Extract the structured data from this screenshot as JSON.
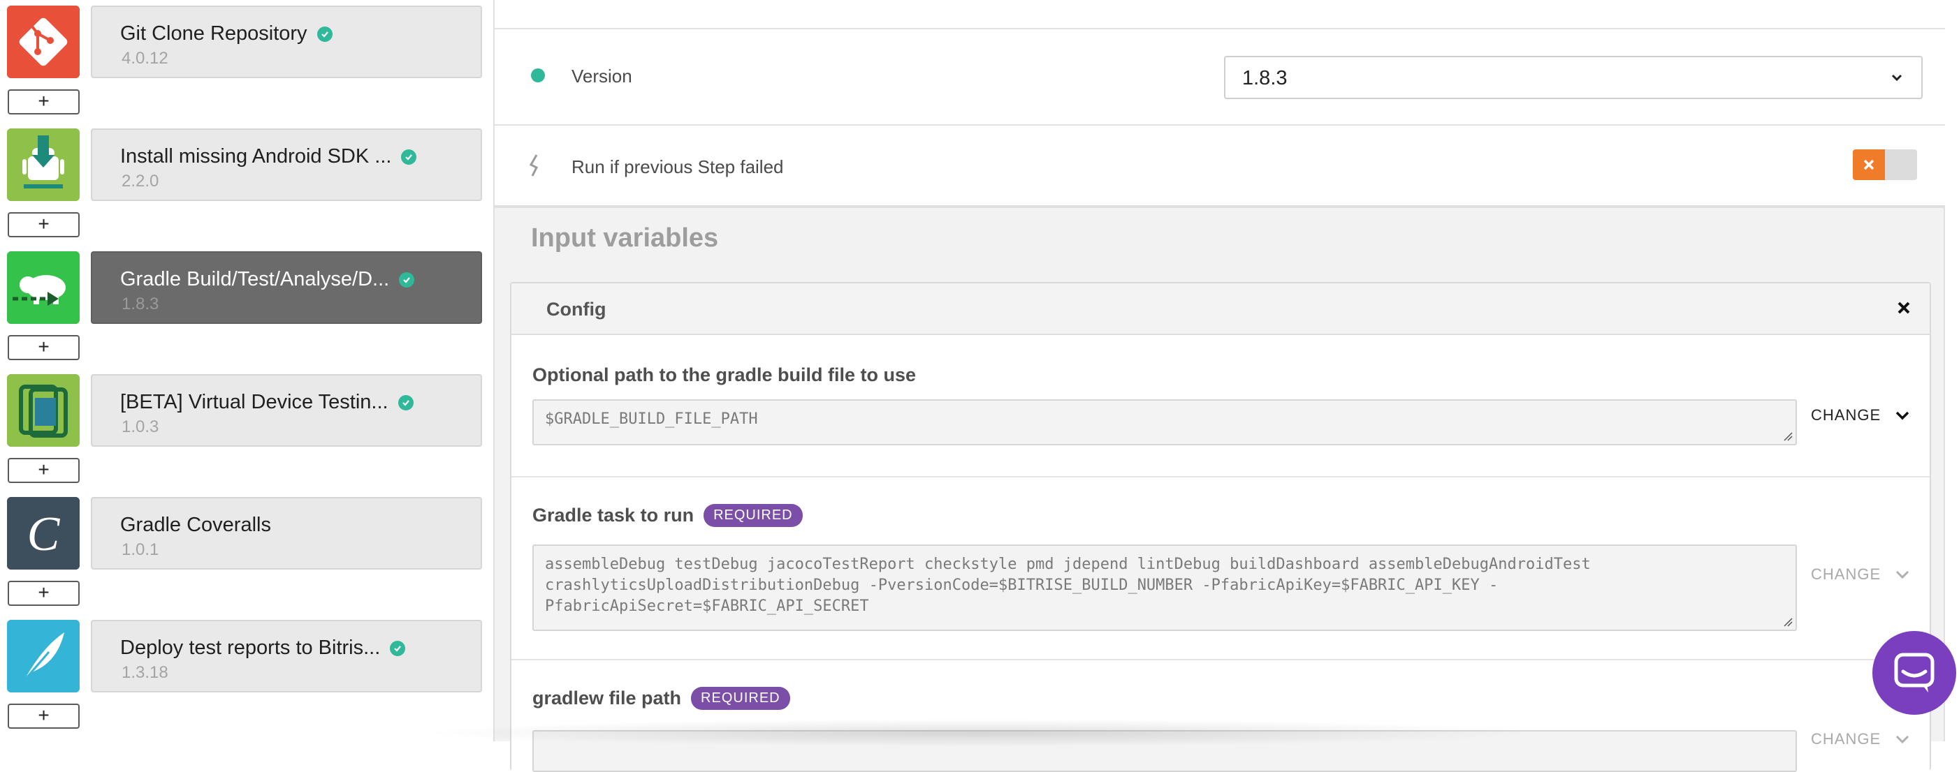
{
  "steps": [
    {
      "title": "Git Clone Repository",
      "version": "4.0.12",
      "icon": "git-icon",
      "color": "#e8503a"
    },
    {
      "title": "Install missing Android SDK ...",
      "version": "2.2.0",
      "icon": "android-sdk-icon",
      "color": "#7cb33d"
    },
    {
      "title": "Gradle Build/Test/Analyse/D...",
      "version": "1.8.3",
      "icon": "gradle-elephant-icon",
      "color": "#2fbf45",
      "active": true
    },
    {
      "title": "[BETA] Virtual Device Testin...",
      "version": "1.0.3",
      "icon": "virtual-device-icon",
      "color": "#7cb33d"
    },
    {
      "title": "Gradle Coveralls",
      "version": "1.0.1",
      "icon": "coveralls-icon",
      "color": "#3c4f5c"
    },
    {
      "title": "Deploy test reports to Bitris...",
      "version": "1.3.18",
      "icon": "deploy-feather-icon",
      "color": "#34b2d6"
    }
  ],
  "add_step_label": "+",
  "version_row": {
    "label": "Version",
    "value": "1.8.3"
  },
  "run_if_failed": {
    "label": "Run if previous Step failed",
    "enabled": false
  },
  "input_variables": {
    "title": "Input variables",
    "group": "Config",
    "variables": [
      {
        "label": "Optional path to the gradle build file to use",
        "value": "$GRADLE_BUILD_FILE_PATH",
        "required": false,
        "change_label": "CHANGE"
      },
      {
        "label": "Gradle task to run",
        "value": "assembleDebug testDebug jacocoTestReport checkstyle pmd jdepend lintDebug buildDashboard assembleDebugAndroidTest crashlyticsUploadDistributionDebug -PversionCode=$BITRISE_BUILD_NUMBER -PfabricApiKey=$FABRIC_API_KEY -PfabricApiSecret=$FABRIC_API_SECRET",
        "required": true,
        "badge": "REQUIRED",
        "change_label": "CHANGE"
      },
      {
        "label": "gradlew file path",
        "value": "",
        "required": true,
        "badge": "REQUIRED",
        "change_label": "CHANGE"
      }
    ]
  },
  "colors": {
    "accent_green": "#2fb89a",
    "required_purple": "#7b4fa8",
    "toggle_orange": "#f07c2a",
    "chat_purple": "#7a3fbf"
  }
}
